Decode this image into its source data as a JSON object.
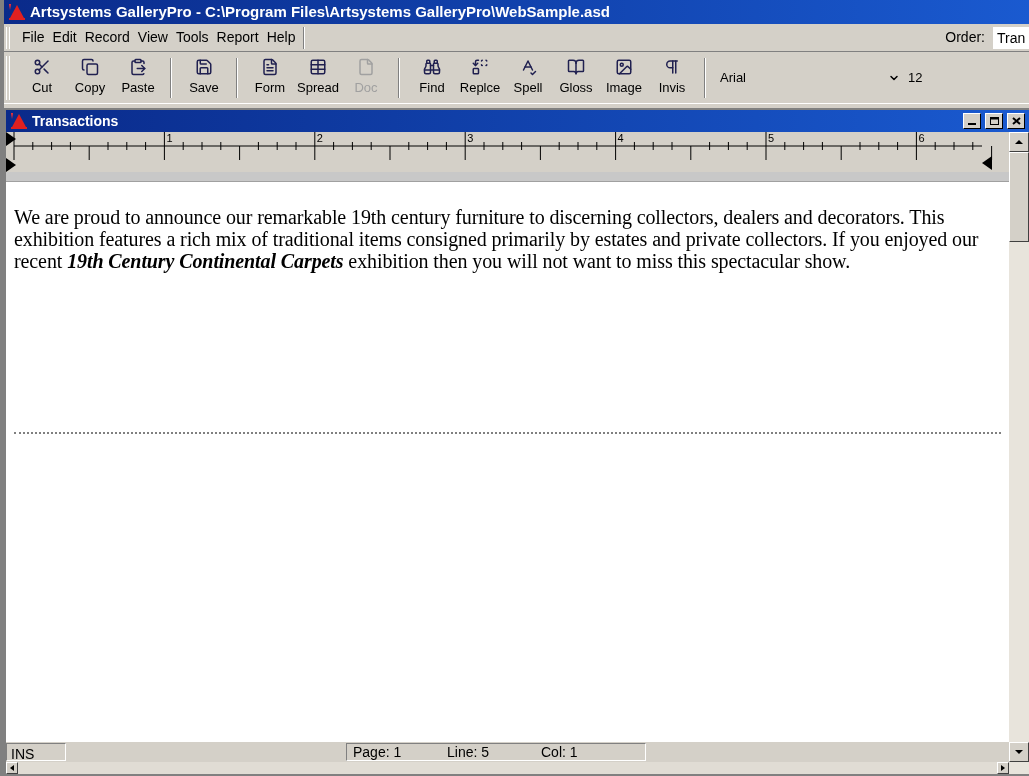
{
  "window": {
    "title": "Artsystems GalleryPro - C:\\Program Files\\Artsystems GalleryPro\\WebSample.asd"
  },
  "menu": [
    "File",
    "Edit",
    "Record",
    "View",
    "Tools",
    "Report",
    "Help"
  ],
  "order": {
    "label": "Order:",
    "value": "Tran"
  },
  "toolbar": {
    "groups": [
      [
        {
          "label": "Cut",
          "disabled": false
        },
        {
          "label": "Copy",
          "disabled": false
        },
        {
          "label": "Paste",
          "disabled": false
        }
      ],
      [
        {
          "label": "Save",
          "disabled": false
        }
      ],
      [
        {
          "label": "Form",
          "disabled": false
        },
        {
          "label": "Spread",
          "disabled": false
        },
        {
          "label": "Doc",
          "disabled": true
        }
      ],
      [
        {
          "label": "Find",
          "disabled": false
        },
        {
          "label": "Replce",
          "disabled": false
        },
        {
          "label": "Spell",
          "disabled": false
        },
        {
          "label": "Gloss",
          "disabled": false
        },
        {
          "label": "Image",
          "disabled": false
        },
        {
          "label": "Invis",
          "disabled": false
        }
      ]
    ],
    "font": "Arial",
    "size": "12"
  },
  "document": {
    "title": "Transactions",
    "ruler": [
      "1",
      "2",
      "3",
      "4",
      "5",
      "6"
    ],
    "text": [
      {
        "kind": "plain",
        "text": "We are proud to announce our remarkable 19th century furniture to discerning collectors, dealers and decorators. This exhibition features a rich mix of traditional items consigned primarily by estates and private collectors. If you enjoyed our recent "
      },
      {
        "kind": "title",
        "text": "19th Century Continental Carpets"
      },
      {
        "kind": "plain",
        "text": " exhibition then you will not want to miss this spectacular show."
      }
    ],
    "status": [
      "INS",
      "Page: 1",
      "Line: 5",
      "Col: 1"
    ]
  }
}
